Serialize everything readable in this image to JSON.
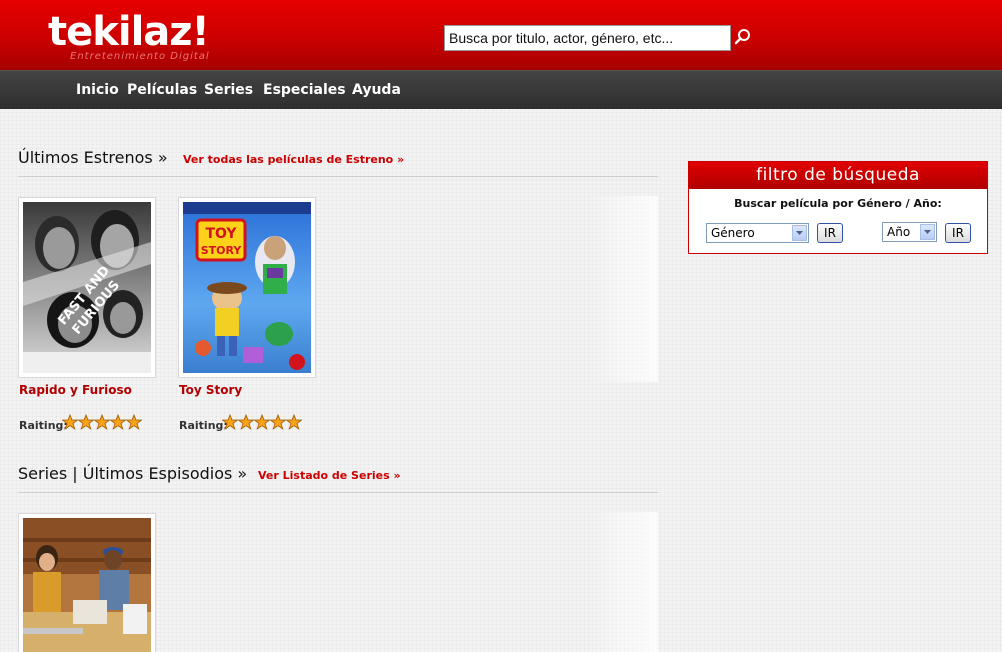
{
  "header": {
    "logo": "tekilaz!",
    "tagline": "Entretenimiento Digital",
    "search_placeholder": "Busca por titulo, actor, género, etc..."
  },
  "nav": {
    "items": [
      "Inicio",
      "Películas",
      "Series",
      "Especiales",
      "Ayuda"
    ]
  },
  "estrenos": {
    "title": "Últimos Estrenos »",
    "link": "Ver todas las películas de Estreno »",
    "movies": [
      {
        "title": "Rapido y Furioso",
        "rating_label": "Raiting:",
        "rating": 5
      },
      {
        "title": "Toy Story",
        "rating_label": "Raiting:",
        "rating": 5
      }
    ]
  },
  "series": {
    "title": "Series | Últimos Espisodios »",
    "link": "Ver Listado de Series »"
  },
  "filter": {
    "title": "filtro de búsqueda",
    "subtitle": "Buscar película por Género / Año:",
    "genre_selected": "Género",
    "year_selected": "Año",
    "go_label": "IR"
  },
  "colors": {
    "brand_red": "#cc0000",
    "nav_dark": "#333333",
    "link_red": "#cc0000"
  }
}
